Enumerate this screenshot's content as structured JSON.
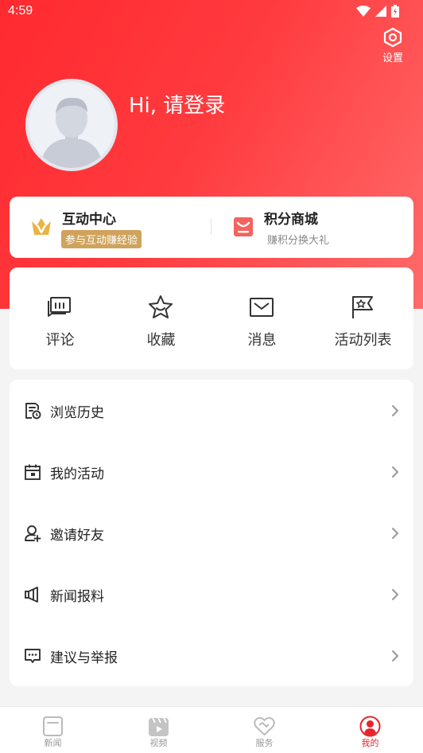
{
  "status_bar": {
    "time": "4:59"
  },
  "header": {
    "settings_label": "设置",
    "greeting": "Hi, 请登录"
  },
  "features": [
    {
      "title": "互动中心",
      "subtitle": "参与互动赚经验",
      "icon": "crown-icon"
    },
    {
      "title": "积分商城",
      "subtitle": "赚积分换大礼",
      "icon": "shopping-bag-icon"
    }
  ],
  "quick_actions": [
    {
      "label": "评论",
      "icon": "comment-icon"
    },
    {
      "label": "收藏",
      "icon": "star-icon"
    },
    {
      "label": "消息",
      "icon": "mail-icon"
    },
    {
      "label": "活动列表",
      "icon": "flag-icon"
    }
  ],
  "menu_items": [
    {
      "label": "浏览历史",
      "icon": "history-icon"
    },
    {
      "label": "我的活动",
      "icon": "calendar-icon"
    },
    {
      "label": "邀请好友",
      "icon": "add-user-icon"
    },
    {
      "label": "新闻报料",
      "icon": "megaphone-icon"
    },
    {
      "label": "建议与举报",
      "icon": "feedback-icon"
    }
  ],
  "tabs": [
    {
      "label": "新闻",
      "icon": "news-icon",
      "active": false
    },
    {
      "label": "视频",
      "icon": "video-icon",
      "active": false
    },
    {
      "label": "服务",
      "icon": "service-icon",
      "active": false
    },
    {
      "label": "我的",
      "icon": "profile-icon",
      "active": true
    }
  ],
  "colors": {
    "brand": "#ff2a2f",
    "active_tab": "#e8242b",
    "gold": "#cfa35b"
  }
}
